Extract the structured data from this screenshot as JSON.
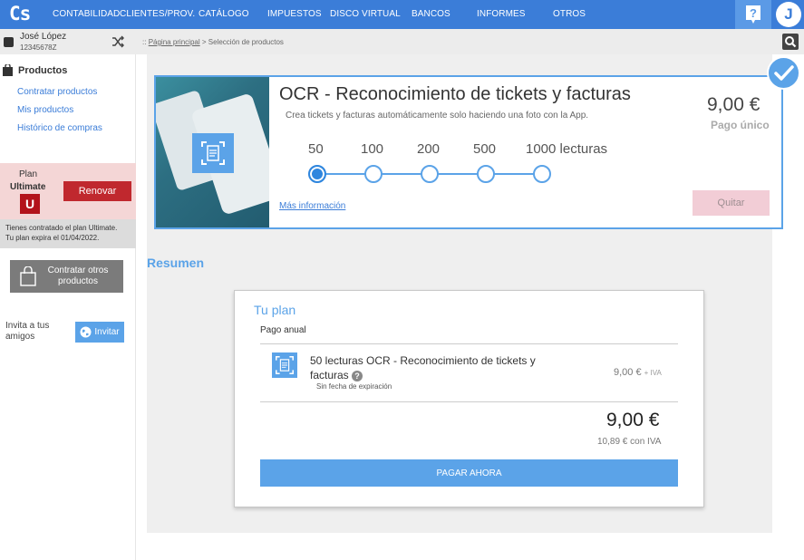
{
  "topbar": {
    "logo": "Cs",
    "nav": [
      "CONTABILIDAD",
      "CLIENTES/PROV.",
      "CATÁLOGO",
      "IMPUESTOS",
      "DISCO VIRTUAL",
      "BANCOS",
      "INFORMES",
      "OTROS"
    ],
    "avatar_letter": "J",
    "help_icon": "help-icon"
  },
  "user": {
    "name": "José López",
    "id": "12345678Z"
  },
  "sidebar": {
    "products_heading": "Productos",
    "links": [
      "Contratar productos",
      "Mis productos",
      "Histórico de compras"
    ],
    "plan_label": "Plan",
    "plan_name": "Ultimate",
    "plan_badge": "U",
    "renew_label": "Renovar",
    "plan_info_line1": "Tienes contratado el plan Ultimate.",
    "plan_info_line2": "Tu plan expira el 01/04/2022.",
    "contract_label": "Contratar otros productos",
    "invite_text": "Invita a tus amigos",
    "invite_label": "Invitar"
  },
  "breadcrumb": {
    "home": "Página principal",
    "current": "Selección de productos",
    "prefix": "::"
  },
  "product": {
    "title": "OCR - Reconocimiento de tickets y facturas",
    "subtitle": "Crea tickets y facturas automáticamente solo haciendo una foto con la App.",
    "price": "9,00 €",
    "price_note": "Pago único",
    "steps": [
      "50",
      "100",
      "200",
      "500",
      "1000 lecturas"
    ],
    "selected_step": 0,
    "more_info": "Más información",
    "remove_label": "Quitar"
  },
  "summary": {
    "heading": "Resumen",
    "plan_title": "Tu plan",
    "billing": "Pago anual",
    "item_title": "50 lecturas OCR - Reconocimiento de tickets y facturas",
    "item_note": "Sin fecha de expiración",
    "item_price": "9,00 €",
    "item_tax": "+ IVA",
    "total": "9,00 €",
    "total_with_tax": "10,89 € con IVA",
    "pay_label": "PAGAR AHORA"
  },
  "colors": {
    "brand_blue": "#3b7dd8",
    "accent_blue": "#5ba3e8",
    "renew_red": "#c0282e"
  }
}
